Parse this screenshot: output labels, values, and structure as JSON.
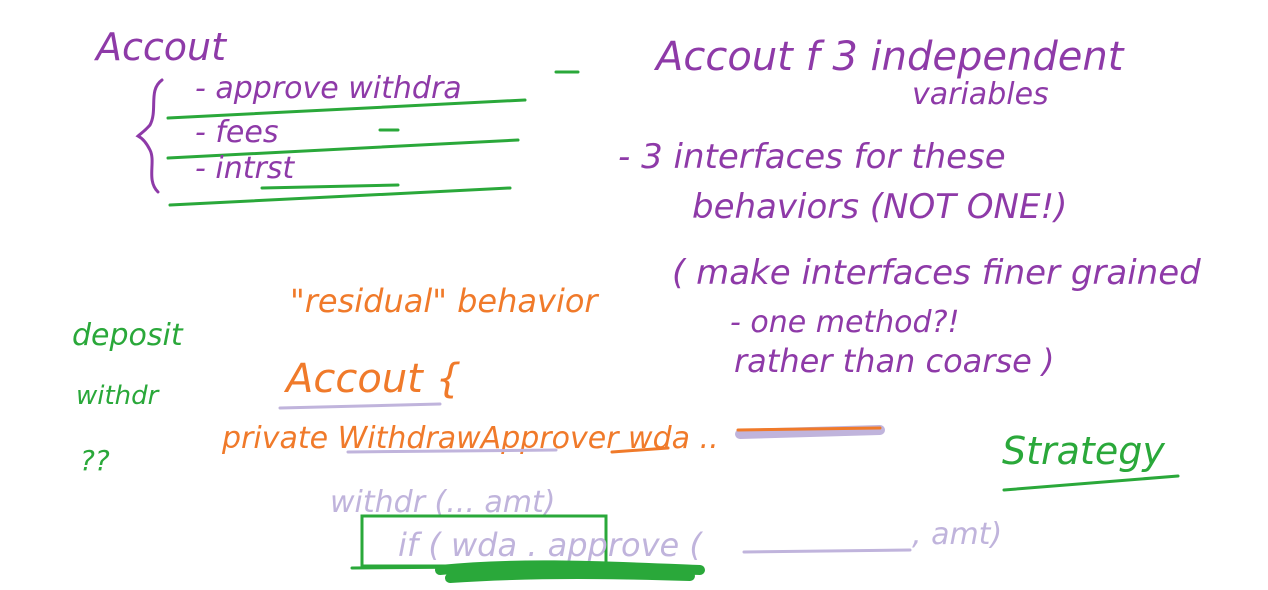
{
  "notes": {
    "account_title": "Accout",
    "list_item_1": "- approve withdra",
    "list_item_2": "- fees",
    "list_item_3": "- intrst",
    "right_line_1": "Accout f 3 independent",
    "right_line_2": "variables",
    "right_line_3": "- 3 interfaces for these",
    "right_line_4": "behaviors (NOT ONE!)",
    "right_line_5": "( make interfaces finer grained",
    "right_line_6": "- one method?!",
    "right_line_7": "rather than coarse )",
    "residual": "\"residual\" behavior",
    "account_code": "Accout {",
    "private_line": "private WithdrawApprover wda ..",
    "left_green_1": "deposit",
    "left_green_2": "withdr",
    "left_green_3": "??",
    "withdraw_sig": "withdr (...  amt)",
    "if_line": "if ( wda . approve (",
    "amt_tail": ", amt)",
    "strategy": "Strategy"
  },
  "colors": {
    "purple": "#8e3aa8",
    "green": "#2aa83a",
    "orange": "#f07a2a",
    "lavender": "#c0b4dc"
  }
}
